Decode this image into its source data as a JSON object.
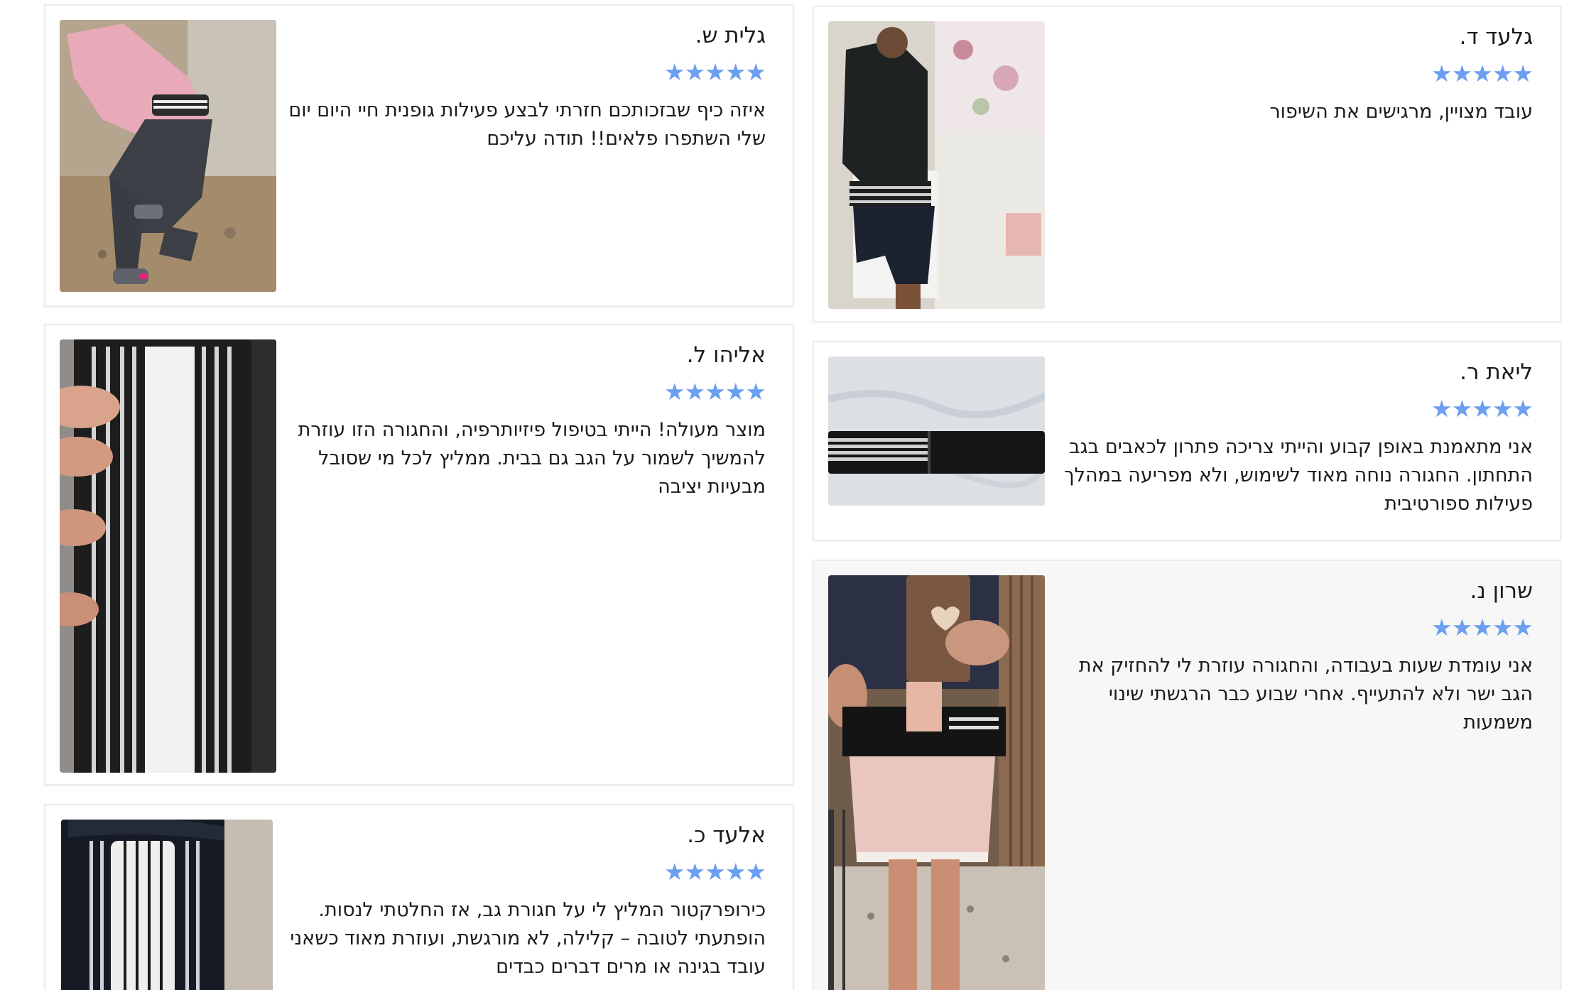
{
  "accent": {
    "star_color": "#6c9ff0",
    "star_glyph": "★"
  },
  "reviews": [
    {
      "name": "גלעד ד.",
      "rating": 5,
      "text": "עובד מצויין, מרגישים את השיפור",
      "photo_icon": "man-wearing-back-brace-photo"
    },
    {
      "name": "גלית ש.",
      "rating": 5,
      "text": "איזה כיף שבזכותכם חזרתי לבצע פעילות גופנית חיי היום יום שלי השתפרו פלאים!! תודה עליכם",
      "photo_icon": "woman-squatting-with-belt-photo"
    },
    {
      "name": "ליאת ר.",
      "rating": 5,
      "text": "אני מתאמנת באופן קבוע והייתי צריכה פתרון לכאבים בגב התחתון. החגורה נוחה מאוד לשימוש, ולא מפריעה במהלך פעילות ספורטיבית",
      "photo_icon": "belt-on-table-photo"
    },
    {
      "name": "אליהו ל.",
      "rating": 5,
      "text": "מוצר מעולה! הייתי בטיפול פיזיותרפיה, והחגורה הזו עוזרת להמשיך לשמור על הגב גם בבית. ממליץ לכל מי שסובל מבעיות יציבה",
      "photo_icon": "hand-holding-belt-photo"
    },
    {
      "name": "שרון נ.",
      "rating": 5,
      "text": "אני עומדת שעות בעבודה, והחגורה עוזרת לי להחזיק את הגב ישר ולא להתעייף. אחרי שבוע כבר הרגשתי שינוי משמעות",
      "photo_icon": "mirror-selfie-with-belt-photo"
    },
    {
      "name": "אלעד כ.",
      "rating": 5,
      "text": "כירופרקטור המליץ לי על חגורת גב, אז החלטתי לנסות. הופתעתי לטובה – קלילה, לא מורגשת, ועוזרת מאוד כשאני עובד בגינה או מרים דברים כבדים",
      "photo_icon": "rolled-belt-photo"
    }
  ]
}
